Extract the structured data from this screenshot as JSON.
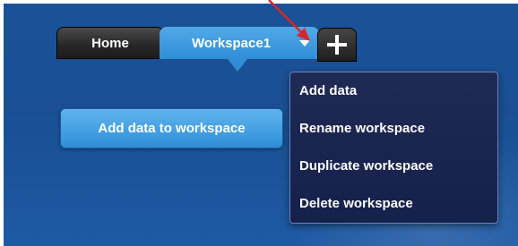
{
  "tabs": {
    "home_label": "Home",
    "workspace_label": "Workspace1",
    "add_tab_icon": "plus-icon",
    "workspace_menu_icon": "chevron-down-icon"
  },
  "main": {
    "add_data_button_label": "Add data to workspace"
  },
  "workspace_menu": {
    "items": [
      {
        "label": "Add data"
      },
      {
        "label": "Rename workspace"
      },
      {
        "label": "Duplicate workspace"
      },
      {
        "label": "Delete workspace"
      }
    ]
  },
  "colors": {
    "background": "#1b5296",
    "active_tab": "#2f8ed6",
    "inactive_tab": "#262626",
    "menu_background": "#1a2550",
    "annotation_arrow": "#d9262c"
  }
}
